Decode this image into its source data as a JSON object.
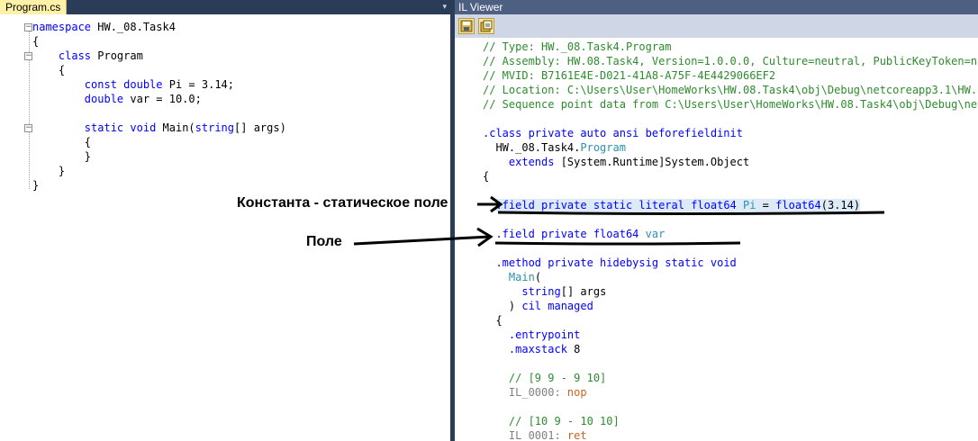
{
  "left_editor": {
    "tab_label": "Program.cs",
    "dropdown_icon": "▾",
    "lines": [
      [
        {
          "t": "namespace",
          "c": "kw"
        },
        {
          "t": " HW._08.Task4",
          "c": ""
        }
      ],
      [
        {
          "t": "{",
          "c": ""
        }
      ],
      [
        {
          "t": "    ",
          "c": ""
        },
        {
          "t": "class",
          "c": "kw"
        },
        {
          "t": " Program",
          "c": ""
        }
      ],
      [
        {
          "t": "    {",
          "c": ""
        }
      ],
      [
        {
          "t": "        ",
          "c": ""
        },
        {
          "t": "const",
          "c": "kw"
        },
        {
          "t": " ",
          "c": ""
        },
        {
          "t": "double",
          "c": "kw"
        },
        {
          "t": " Pi = 3.14;",
          "c": ""
        }
      ],
      [
        {
          "t": "        ",
          "c": ""
        },
        {
          "t": "double",
          "c": "kw"
        },
        {
          "t": " var = 10.0;",
          "c": ""
        }
      ],
      [
        {
          "t": "",
          "c": ""
        }
      ],
      [
        {
          "t": "        ",
          "c": ""
        },
        {
          "t": "static",
          "c": "kw"
        },
        {
          "t": " ",
          "c": ""
        },
        {
          "t": "void",
          "c": "kw"
        },
        {
          "t": " Main(",
          "c": ""
        },
        {
          "t": "string",
          "c": "kw"
        },
        {
          "t": "[] args)",
          "c": ""
        }
      ],
      [
        {
          "t": "        {",
          "c": ""
        }
      ],
      [
        {
          "t": "        }",
          "c": ""
        }
      ],
      [
        {
          "t": "    }",
          "c": ""
        }
      ],
      [
        {
          "t": "}",
          "c": ""
        }
      ]
    ]
  },
  "right_viewer": {
    "title": "IL Viewer",
    "toolbar_icons": [
      "save-icon",
      "tools-icon"
    ],
    "lines": [
      [
        {
          "t": "// Type: HW._08.Task4.Program",
          "c": "cm"
        }
      ],
      [
        {
          "t": "// Assembly: HW.08.Task4, Version=1.0.0.0, Culture=neutral, PublicKeyToken=nu",
          "c": "cm"
        }
      ],
      [
        {
          "t": "// MVID: B7161E4E-D021-41A8-A75F-4E4429066EF2",
          "c": "cm"
        }
      ],
      [
        {
          "t": "// Location: C:\\Users\\User\\HomeWorks\\HW.08.Task4\\obj\\Debug\\netcoreapp3.1\\HW.0",
          "c": "cm"
        }
      ],
      [
        {
          "t": "// Sequence point data from C:\\Users\\User\\HomeWorks\\HW.08.Task4\\obj\\Debug\\net",
          "c": "cm"
        }
      ],
      [
        {
          "t": "",
          "c": ""
        }
      ],
      [
        {
          "t": ".class private auto ansi beforefieldinit",
          "c": "dir"
        }
      ],
      [
        {
          "t": "  HW._08.Task4.",
          "c": ""
        },
        {
          "t": "Program",
          "c": "teal"
        }
      ],
      [
        {
          "t": "    ",
          "c": ""
        },
        {
          "t": "extends",
          "c": "dir"
        },
        {
          "t": " [System.Runtime]System.Object",
          "c": ""
        }
      ],
      [
        {
          "t": "{",
          "c": ""
        }
      ],
      [
        {
          "t": "",
          "c": ""
        }
      ],
      [
        {
          "t": "  ",
          "c": ""
        },
        {
          "t": ".field private static literal float64",
          "c": "dir hl"
        },
        {
          "t": " ",
          "c": "hl"
        },
        {
          "t": "Pi",
          "c": "teal hl"
        },
        {
          "t": " = ",
          "c": "hl"
        },
        {
          "t": "float64",
          "c": "dir hl"
        },
        {
          "t": "(3.14)",
          "c": "hl"
        }
      ],
      [
        {
          "t": "",
          "c": ""
        }
      ],
      [
        {
          "t": "  ",
          "c": ""
        },
        {
          "t": ".field private float64",
          "c": "dir"
        },
        {
          "t": " ",
          "c": ""
        },
        {
          "t": "var",
          "c": "teal"
        }
      ],
      [
        {
          "t": "",
          "c": ""
        }
      ],
      [
        {
          "t": "  ",
          "c": ""
        },
        {
          "t": ".method private hidebysig static void",
          "c": "dir"
        }
      ],
      [
        {
          "t": "    ",
          "c": ""
        },
        {
          "t": "Main",
          "c": "teal"
        },
        {
          "t": "(",
          "c": ""
        }
      ],
      [
        {
          "t": "      ",
          "c": ""
        },
        {
          "t": "string",
          "c": "dir"
        },
        {
          "t": "[] args",
          "c": ""
        }
      ],
      [
        {
          "t": "    ) ",
          "c": ""
        },
        {
          "t": "cil managed",
          "c": "dir"
        }
      ],
      [
        {
          "t": "  {",
          "c": ""
        }
      ],
      [
        {
          "t": "    ",
          "c": ""
        },
        {
          "t": ".entrypoint",
          "c": "dir"
        }
      ],
      [
        {
          "t": "    ",
          "c": ""
        },
        {
          "t": ".maxstack",
          "c": "dir"
        },
        {
          "t": " 8",
          "c": ""
        }
      ],
      [
        {
          "t": "",
          "c": ""
        }
      ],
      [
        {
          "t": "    // [9 9 - 9 10]",
          "c": "cm"
        }
      ],
      [
        {
          "t": "    IL_0000: ",
          "c": "gray"
        },
        {
          "t": "nop",
          "c": "orange"
        }
      ],
      [
        {
          "t": "",
          "c": ""
        }
      ],
      [
        {
          "t": "    // [10 9 - 10 10]",
          "c": "cm"
        }
      ],
      [
        {
          "t": "    IL_0001: ",
          "c": "gray"
        },
        {
          "t": "ret",
          "c": "orange"
        }
      ]
    ]
  },
  "annotations": {
    "constant_label": "Константа - статическое поле",
    "field_label": "Поле"
  }
}
